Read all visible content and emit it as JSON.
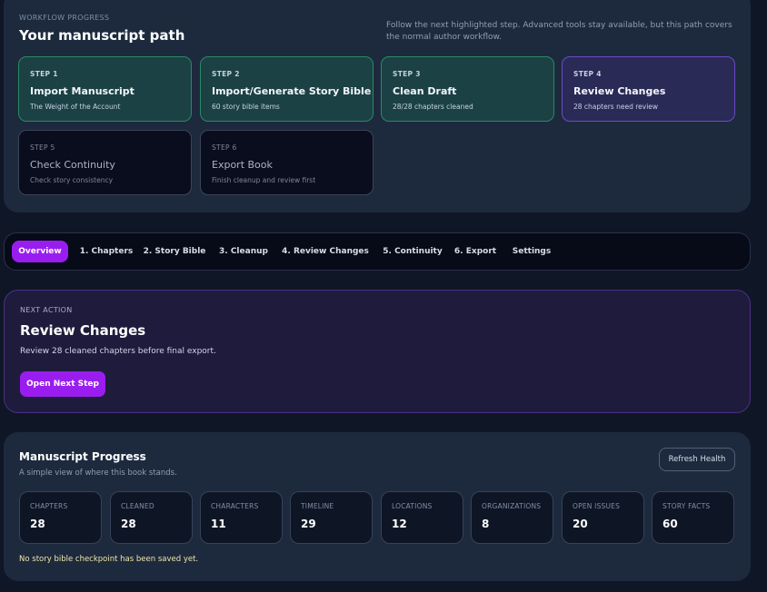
{
  "workflow": {
    "eyebrow": "WORKFLOW PROGRESS",
    "title": "Your manuscript path",
    "description": "Follow the next highlighted step. Advanced tools stay available, but this path covers the normal author workflow.",
    "steps": [
      {
        "number": "STEP 1",
        "title": "Import Manuscript",
        "subtitle": "The Weight of the Account",
        "status": "done"
      },
      {
        "number": "STEP 2",
        "title": "Import/Generate Story Bible",
        "subtitle": "60 story bible items",
        "status": "done"
      },
      {
        "number": "STEP 3",
        "title": "Clean Draft",
        "subtitle": "28/28 chapters cleaned",
        "status": "done"
      },
      {
        "number": "STEP 4",
        "title": "Review Changes",
        "subtitle": "28 chapters need review",
        "status": "current"
      },
      {
        "number": "STEP 5",
        "title": "Check Continuity",
        "subtitle": "Check story consistency",
        "status": "pending"
      },
      {
        "number": "STEP 6",
        "title": "Export Book",
        "subtitle": "Finish cleanup and review first",
        "status": "pending"
      }
    ]
  },
  "tabs": [
    {
      "label": "Overview",
      "active": true
    },
    {
      "label": "1. Chapters",
      "active": false
    },
    {
      "label": "2. Story Bible",
      "active": false
    },
    {
      "label": "3. Cleanup",
      "active": false
    },
    {
      "label": "4. Review Changes",
      "active": false
    },
    {
      "label": "5. Continuity",
      "active": false
    },
    {
      "label": "6. Export",
      "active": false
    },
    {
      "label": "Settings",
      "active": false
    }
  ],
  "next_action": {
    "eyebrow": "NEXT ACTION",
    "title": "Review Changes",
    "description": "Review 28 cleaned chapters before final export.",
    "button_label": "Open Next Step"
  },
  "progress": {
    "title": "Manuscript Progress",
    "subtitle": "A simple view of where this book stands.",
    "refresh_label": "Refresh Health",
    "stats": [
      {
        "label": "CHAPTERS",
        "value": "28"
      },
      {
        "label": "CLEANED",
        "value": "28"
      },
      {
        "label": "CHARACTERS",
        "value": "11"
      },
      {
        "label": "TIMELINE",
        "value": "29"
      },
      {
        "label": "LOCATIONS",
        "value": "12"
      },
      {
        "label": "ORGANIZATIONS",
        "value": "8"
      },
      {
        "label": "OPEN ISSUES",
        "value": "20"
      },
      {
        "label": "STORY FACTS",
        "value": "60"
      }
    ],
    "note": "No story bible checkpoint has been saved yet."
  },
  "colors": {
    "accent": "#9a1df0",
    "done_bg": "#1b4144",
    "current_bg": "#2a2a56",
    "note_text": "#f0e6a8"
  }
}
